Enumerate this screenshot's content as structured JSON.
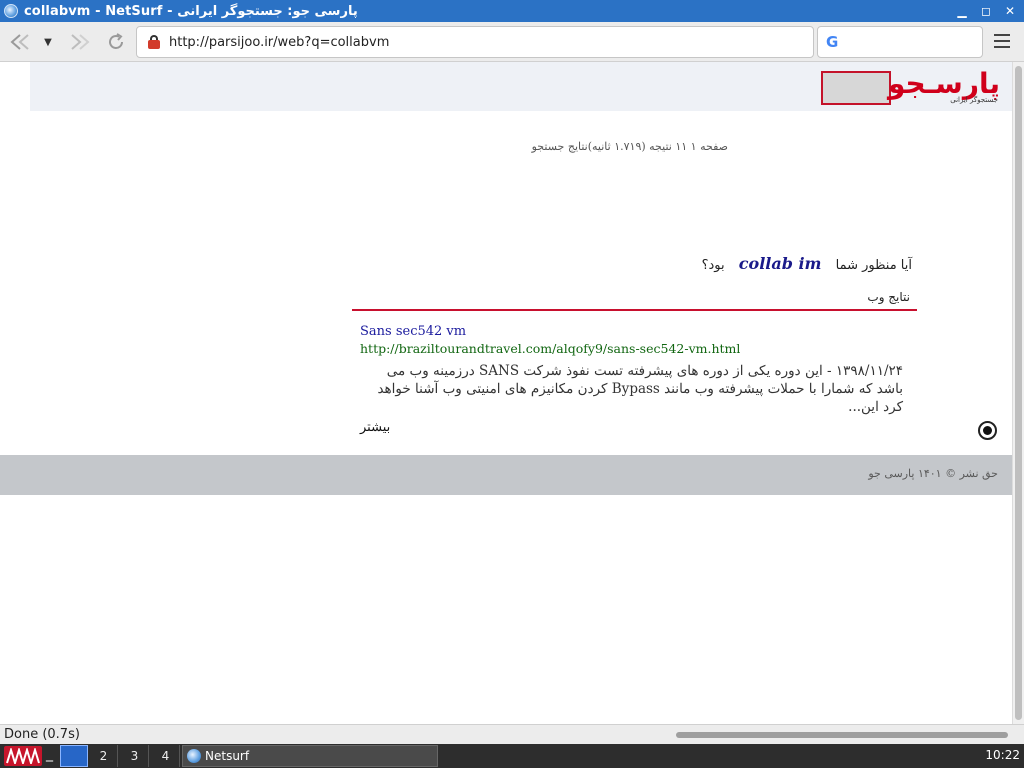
{
  "window": {
    "title": "collabvm - NetSurf - پارسی جو: جستجوگر ایرانی",
    "controls": [
      "minimize",
      "maximize",
      "close"
    ]
  },
  "toolbar": {
    "url": "http://parsijoo.ir/web?q=collabvm",
    "search_placeholder": ""
  },
  "page": {
    "logo_text": "پارسـجو",
    "logo_sub": "جستجوگر ایرانی",
    "result_summary": "صفحه ۱ ۱۱ نتیجه (۱.۷۱۹ ثانیه)نتایج جستجو",
    "didyoumean_prefix": "آیا منظور شما",
    "didyoumean_suggest": "collab im",
    "didyoumean_suffix": "بود؟",
    "web_results_label": "نتایج وب",
    "result": {
      "title": "Sans sec542 vm",
      "url": "http://braziltourandtravel.com/alqofy9/sans-sec542-vm.html",
      "snippet": "۱۳۹۸/۱۱/۲۴ - این دوره یکی از دوره های پیشرفته تست نفوذ شرکت SANS درزمینه وب می باشد که شمارا با حملات پیشرفته وب مانند Bypass کردن مکانیزم های امنیتی وب آشنا خواهد کرد این...",
      "more": "بیشتر"
    },
    "footer_copy": "حق نشر © ۱۴۰۱ پارسی جو"
  },
  "statusbar": {
    "status": "Done (0.7s)"
  },
  "taskbar": {
    "dash": "_",
    "workspaces": [
      "1",
      "2",
      "3",
      "4"
    ],
    "task_label": "Netsurf",
    "clock": "10:22"
  }
}
